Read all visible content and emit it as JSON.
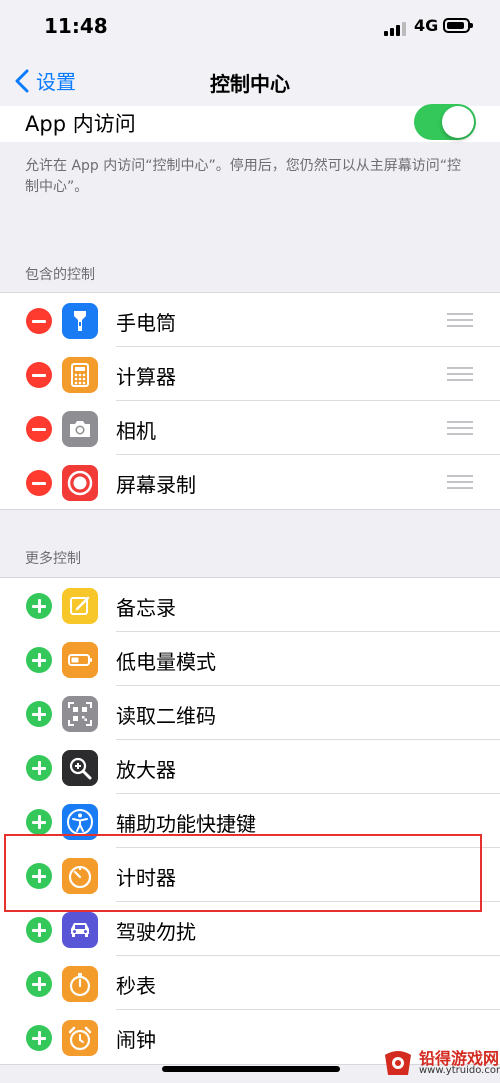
{
  "status_bar": {
    "time": "11:48",
    "network": "4G"
  },
  "nav": {
    "back_label": "设置",
    "title": "控制中心"
  },
  "app_access": {
    "label": "App 内访问",
    "enabled": true,
    "footer": "允许在 App 内访问“控制中心”。停用后，您仍然可以从主屏幕访问“控制中心”。"
  },
  "included": {
    "header": "包含的控制",
    "items": [
      {
        "label": "手电筒",
        "icon": "flashlight-icon",
        "color": "#1a7cf5"
      },
      {
        "label": "计算器",
        "icon": "calculator-icon",
        "color": "#f39c2c"
      },
      {
        "label": "相机",
        "icon": "camera-icon",
        "color": "#8e8e93"
      },
      {
        "label": "屏幕录制",
        "icon": "screen-record-icon",
        "color": "#f23a37"
      }
    ]
  },
  "more": {
    "header": "更多控制",
    "items": [
      {
        "label": "备忘录",
        "icon": "notes-icon",
        "color": "#f7c729"
      },
      {
        "label": "低电量模式",
        "icon": "low-power-icon",
        "color": "#f39c2c"
      },
      {
        "label": "读取二维码",
        "icon": "qr-code-icon",
        "color": "#8e8e93"
      },
      {
        "label": "放大器",
        "icon": "magnifier-icon",
        "color": "#2c2c2e"
      },
      {
        "label": "辅助功能快捷键",
        "icon": "accessibility-icon",
        "color": "#1a7cf5"
      },
      {
        "label": "计时器",
        "icon": "timer-icon",
        "color": "#f39c2c"
      },
      {
        "label": "驾驶勿扰",
        "icon": "car-icon",
        "color": "#5856d6"
      },
      {
        "label": "秒表",
        "icon": "stopwatch-icon",
        "color": "#f39c2c"
      },
      {
        "label": "闹钟",
        "icon": "alarm-icon",
        "color": "#f39c2c"
      }
    ]
  },
  "watermark": {
    "name": "铅得游戏网",
    "url": "www.ytruido.com"
  }
}
